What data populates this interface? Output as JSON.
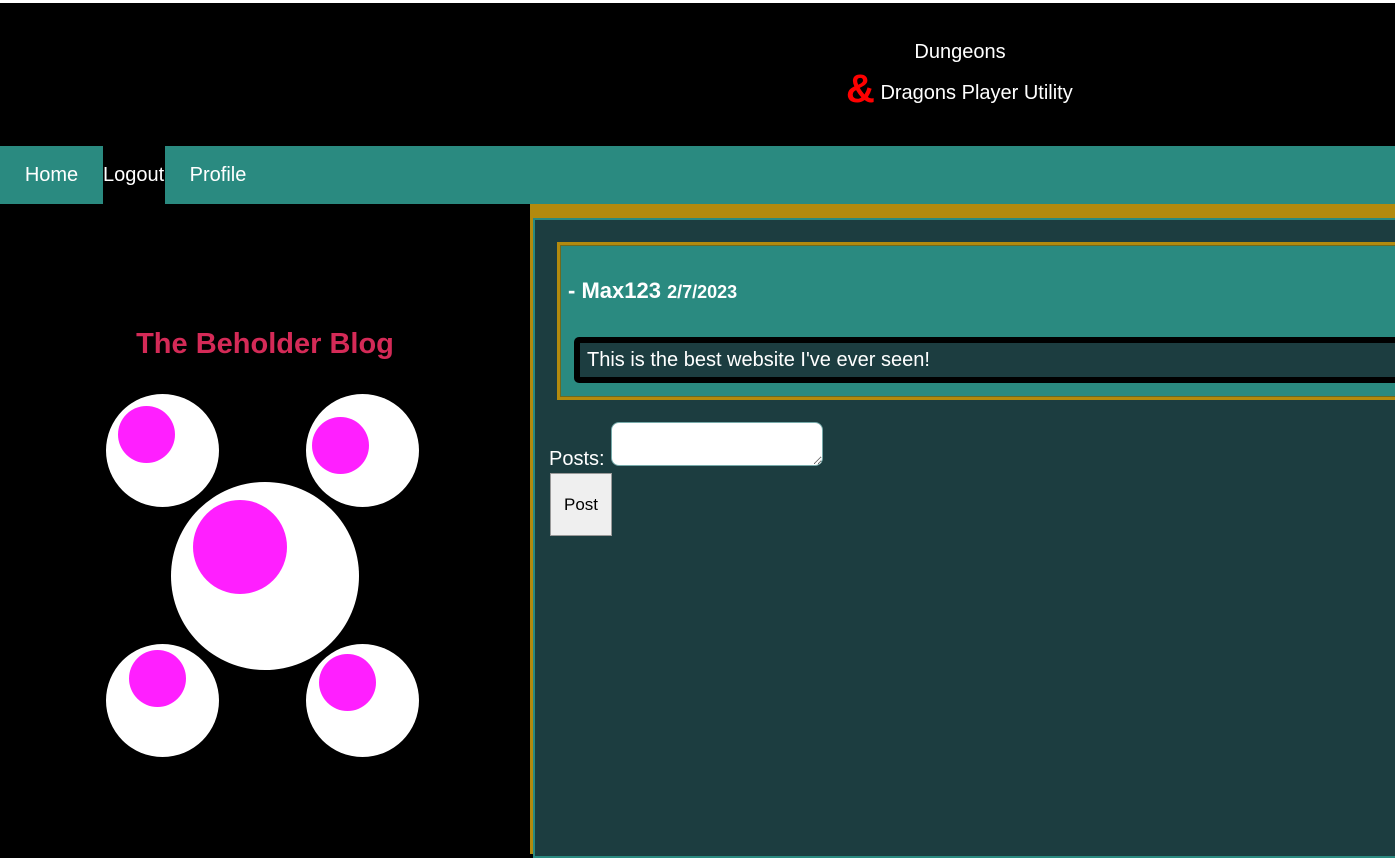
{
  "header": {
    "title_line1": "Dungeons",
    "ampersand": "&",
    "title_line2": "Dragons Player Utility"
  },
  "nav": {
    "home": "Home",
    "logout": "Logout",
    "profile": "Profile"
  },
  "sidebar": {
    "blog_title": "The Beholder Blog"
  },
  "post": {
    "prefix": "- ",
    "author": "Max123",
    "date": "2/7/2023",
    "body": "This is the best website I've ever seen!"
  },
  "composer": {
    "label": "Posts:",
    "textarea_value": "",
    "button_label": "Post"
  },
  "colors": {
    "nav_bg": "#2a8a80",
    "blog_title": "#d42a57",
    "pupil": "#ff1fff",
    "accent_gold": "#b28a0e",
    "panel_bg": "#1c3d40",
    "ampersand": "#ff0000"
  }
}
